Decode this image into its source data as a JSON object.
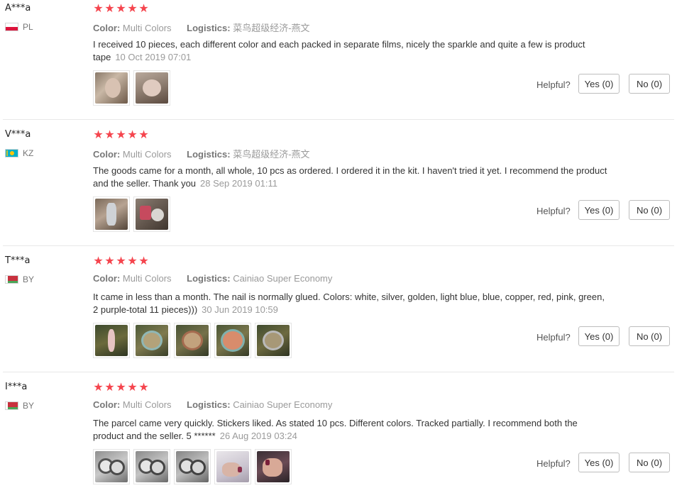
{
  "labels": {
    "color_key": "Color:",
    "logistics_key": "Logistics:",
    "helpful": "Helpful?"
  },
  "star_color": "#f5454e",
  "reviews": [
    {
      "user": "A***a",
      "country": "PL",
      "flag": "poland-flag",
      "rating": 5,
      "color": "Multi Colors",
      "logistics": "菜鸟超级经济-燕文",
      "text": "I received 10 pieces, each different color and each packed in separate films, nicely the sparkle and quite a few is product tape",
      "date": "10 Oct 2019 07:01",
      "photos": [
        "review-photo",
        "review-photo"
      ],
      "yes": "Yes (0)",
      "no": "No (0)"
    },
    {
      "user": "V***a",
      "country": "KZ",
      "flag": "kazakhstan-flag",
      "rating": 5,
      "color": "Multi Colors",
      "logistics": "菜鸟超级经济-燕文",
      "text": "The goods came for a month, all whole, 10 pcs as ordered. I ordered it in the kit. I haven't tried it yet. I recommend the product and the seller. Thank you",
      "date": "28 Sep 2019 01:11",
      "photos": [
        "review-photo",
        "review-photo"
      ],
      "yes": "Yes (0)",
      "no": "No (0)"
    },
    {
      "user": "T***a",
      "country": "BY",
      "flag": "belarus-flag",
      "rating": 5,
      "color": "Multi Colors",
      "logistics": "Cainiao Super Economy",
      "text": "It came in less than a month. The nail is normally glued. Colors: white, silver, golden, light blue, blue, copper, red, pink, green, 2 purple-total 11 pieces)))",
      "date": "30 Jun 2019 10:59",
      "photos": [
        "review-photo",
        "review-photo",
        "review-photo",
        "review-photo",
        "review-photo"
      ],
      "yes": "Yes (0)",
      "no": "No (0)"
    },
    {
      "user": "I***a",
      "country": "BY",
      "flag": "belarus-flag",
      "rating": 5,
      "color": "Multi Colors",
      "logistics": "Cainiao Super Economy",
      "text": "The parcel came very quickly. Stickers liked. As stated 10 pcs. Different colors. Tracked partially. I recommend both the product and the seller. 5 ******",
      "date": "26 Aug 2019 03:24",
      "photos": [
        "review-photo",
        "review-photo",
        "review-photo",
        "review-photo",
        "review-photo"
      ],
      "yes": "Yes (0)",
      "no": "No (0)"
    }
  ]
}
